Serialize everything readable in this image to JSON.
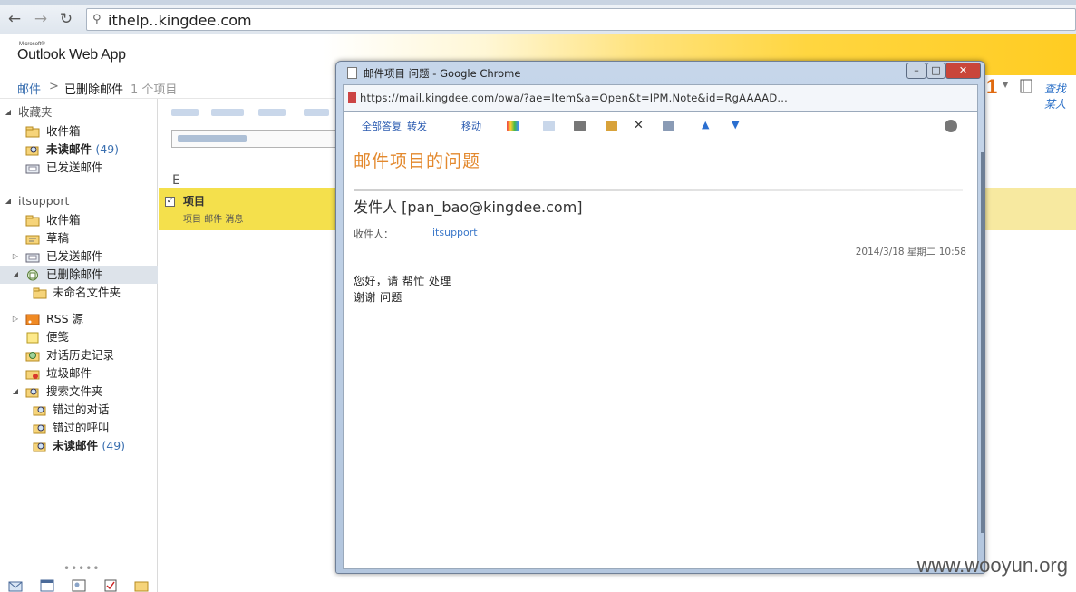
{
  "browser": {
    "url": "ithelp..kingdee.com"
  },
  "owa": {
    "ms_small": "Microsoft®",
    "logo": "Outlook Web App"
  },
  "breadcrumb": {
    "root": "邮件",
    "separator": ">",
    "current": "已删除邮件",
    "count": "1 个项目"
  },
  "right": {
    "badge": "1",
    "find": "查找某人"
  },
  "nav": {
    "favorites_label": "收藏夹",
    "favorites": [
      {
        "label": "收件箱",
        "count": "",
        "icon": "inbox-icon"
      },
      {
        "label": "未读邮件",
        "count": "(49)",
        "icon": "search-folder-icon"
      },
      {
        "label": "已发送邮件",
        "count": "",
        "icon": "sent-icon"
      }
    ],
    "mailbox_label": "itsupport",
    "folders": [
      {
        "label": "收件箱",
        "icon": "inbox-icon"
      },
      {
        "label": "草稿",
        "icon": "drafts-icon"
      },
      {
        "label": "已发送邮件",
        "icon": "sent-icon"
      },
      {
        "label": "已删除邮件",
        "icon": "trash-icon"
      },
      {
        "label": "未命名文件夹",
        "icon": "folder-icon"
      },
      {
        "label": "RSS 源",
        "icon": "rss-icon"
      },
      {
        "label": "便笺",
        "icon": "notes-icon"
      },
      {
        "label": "对话历史记录",
        "icon": "history-icon"
      },
      {
        "label": "垃圾邮件",
        "icon": "junk-icon"
      },
      {
        "label": "搜索文件夹",
        "icon": "search-folder-icon"
      },
      {
        "label": "错过的对话",
        "icon": "search-folder-icon"
      },
      {
        "label": "错过的呼叫",
        "icon": "search-folder-icon"
      },
      {
        "label": "未读邮件",
        "icon": "search-folder-icon",
        "count": "(49)"
      }
    ],
    "dots": "•••••"
  },
  "list": {
    "group": "E",
    "row_title": "项目",
    "row_sub": "项目 邮件 消息"
  },
  "popup": {
    "title": "邮件项目 问题 - Google Chrome",
    "url": "https://mail.kingdee.com/owa/?ae=Item&a=Open&t=IPM.Note&id=RgAAAAD...",
    "toolbar": [
      "全部答复",
      "转发",
      "移动"
    ],
    "subject": "邮件项目的问题",
    "sender": "发件人 [pan_bao@kingdee.com]",
    "meta_label": "收件人：",
    "meta_link": "itsupport",
    "date": "2014/3/18 星期二 10:58",
    "body_lines": [
      "您好，请 帮忙 处理",
      "谢谢 问题"
    ]
  },
  "watermark": "www.wooyun.org",
  "colors": {
    "accent_yellow": "#f4e04c",
    "link_blue": "#3a6fb0",
    "subject_orange": "#e3892e"
  }
}
